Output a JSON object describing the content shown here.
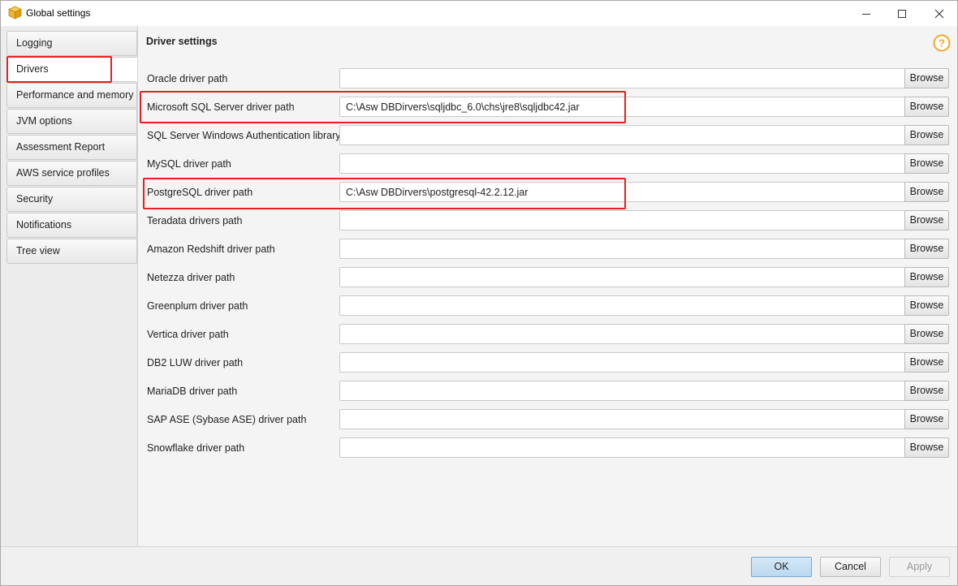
{
  "window": {
    "title": "Global settings"
  },
  "sidebar": {
    "items": [
      {
        "label": "Logging"
      },
      {
        "label": "Drivers"
      },
      {
        "label": "Performance and memory"
      },
      {
        "label": "JVM options"
      },
      {
        "label": "Assessment Report"
      },
      {
        "label": "AWS service profiles"
      },
      {
        "label": "Security"
      },
      {
        "label": "Notifications"
      },
      {
        "label": "Tree view"
      }
    ],
    "selected": "Drivers"
  },
  "main": {
    "section_title": "Driver settings",
    "browse_label": "Browse",
    "rows": [
      {
        "label": "Oracle driver path",
        "value": ""
      },
      {
        "label": "Microsoft SQL Server driver path",
        "value": "C:\\Asw DBDirvers\\sqljdbc_6.0\\chs\\jre8\\sqljdbc42.jar"
      },
      {
        "label": "SQL Server Windows Authentication library",
        "value": ""
      },
      {
        "label": "MySQL driver path",
        "value": ""
      },
      {
        "label": "PostgreSQL driver path",
        "value": "C:\\Asw DBDirvers\\postgresql-42.2.12.jar"
      },
      {
        "label": "Teradata drivers path",
        "value": ""
      },
      {
        "label": "Amazon Redshift driver path",
        "value": ""
      },
      {
        "label": "Netezza driver path",
        "value": ""
      },
      {
        "label": "Greenplum driver path",
        "value": ""
      },
      {
        "label": "Vertica driver path",
        "value": ""
      },
      {
        "label": "DB2 LUW driver path",
        "value": ""
      },
      {
        "label": "MariaDB driver path",
        "value": ""
      },
      {
        "label": "SAP ASE (Sybase ASE) driver path",
        "value": ""
      },
      {
        "label": "Snowflake driver path",
        "value": ""
      }
    ]
  },
  "footer": {
    "ok_label": "OK",
    "cancel_label": "Cancel",
    "apply_label": "Apply"
  },
  "colors": {
    "highlight": "#e8201f",
    "help_icon": "#f5a623",
    "app_icon": "#f2b233"
  }
}
